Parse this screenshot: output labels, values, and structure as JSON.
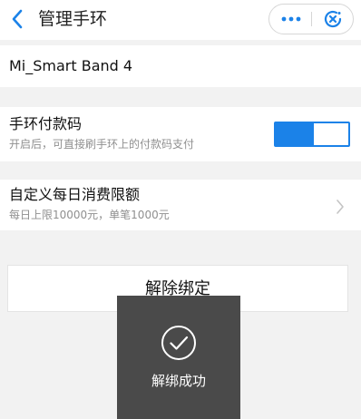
{
  "header": {
    "title": "管理手环",
    "back_icon": "chevron-left-icon",
    "more_icon": "more-dots-icon",
    "close_icon": "target-close-icon",
    "accent_color": "#1b82e8"
  },
  "device": {
    "name": "Mi_Smart Band 4"
  },
  "payment_code": {
    "title": "手环付款码",
    "subtitle": "开启后，可直接刷手环上的付款码支付",
    "enabled": true
  },
  "daily_limit": {
    "title": "自定义每日消费限额",
    "subtitle": "每日上限10000元，单笔1000元",
    "chevron_icon": "chevron-right-icon"
  },
  "unbind": {
    "label": "解除绑定"
  },
  "toast": {
    "icon": "check-circle-icon",
    "text": "解绑成功"
  }
}
